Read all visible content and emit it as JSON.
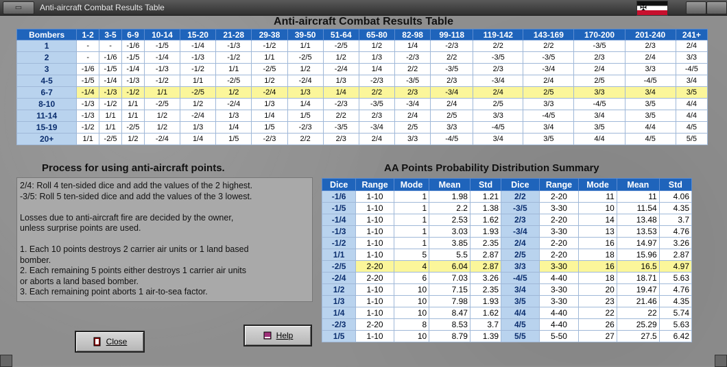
{
  "window": {
    "title": "Anti-aircraft Combat Results Table",
    "menu_label": "▭"
  },
  "crt": {
    "title": "Anti-aircraft Combat Results Table",
    "headers": [
      "Bombers",
      "1-2",
      "3-5",
      "6-9",
      "10-14",
      "15-20",
      "21-28",
      "29-38",
      "39-50",
      "51-64",
      "65-80",
      "82-98",
      "99-118",
      "119-142",
      "143-169",
      "170-200",
      "201-240",
      "241+"
    ],
    "highlight_row": "6-7",
    "rows": [
      [
        "1",
        "-",
        "-",
        "-1/6",
        "-1/5",
        "-1/4",
        "-1/3",
        "-1/2",
        "1/1",
        "-2/5",
        "1/2",
        "1/4",
        "-2/3",
        "2/2",
        "2/2",
        "-3/5",
        "2/3",
        "2/4"
      ],
      [
        "2",
        "-",
        "-1/6",
        "-1/5",
        "-1/4",
        "-1/3",
        "-1/2",
        "1/1",
        "-2/5",
        "1/2",
        "1/3",
        "-2/3",
        "2/2",
        "-3/5",
        "-3/5",
        "2/3",
        "2/4",
        "3/3"
      ],
      [
        "3",
        "-1/6",
        "-1/5",
        "-1/4",
        "-1/3",
        "-1/2",
        "1/1",
        "-2/5",
        "1/2",
        "-2/4",
        "1/4",
        "2/2",
        "-3/5",
        "2/3",
        "-3/4",
        "2/4",
        "3/3",
        "-4/5"
      ],
      [
        "4-5",
        "-1/5",
        "-1/4",
        "-1/3",
        "-1/2",
        "1/1",
        "-2/5",
        "1/2",
        "-2/4",
        "1/3",
        "-2/3",
        "-3/5",
        "2/3",
        "-3/4",
        "2/4",
        "2/5",
        "-4/5",
        "3/4"
      ],
      [
        "6-7",
        "-1/4",
        "-1/3",
        "-1/2",
        "1/1",
        "-2/5",
        "1/2",
        "-2/4",
        "1/3",
        "1/4",
        "2/2",
        "2/3",
        "-3/4",
        "2/4",
        "2/5",
        "3/3",
        "3/4",
        "3/5"
      ],
      [
        "8-10",
        "-1/3",
        "-1/2",
        "1/1",
        "-2/5",
        "1/2",
        "-2/4",
        "1/3",
        "1/4",
        "-2/3",
        "-3/5",
        "-3/4",
        "2/4",
        "2/5",
        "3/3",
        "-4/5",
        "3/5",
        "4/4"
      ],
      [
        "11-14",
        "-1/3",
        "1/1",
        "1/1",
        "1/2",
        "-2/4",
        "1/3",
        "1/4",
        "1/5",
        "2/2",
        "2/3",
        "2/4",
        "2/5",
        "3/3",
        "-4/5",
        "3/4",
        "3/5",
        "4/4"
      ],
      [
        "15-19",
        "-1/2",
        "1/1",
        "-2/5",
        "1/2",
        "1/3",
        "1/4",
        "1/5",
        "-2/3",
        "-3/5",
        "-3/4",
        "2/5",
        "3/3",
        "-4/5",
        "3/4",
        "3/5",
        "4/4",
        "4/5"
      ],
      [
        "20+",
        "1/1",
        "-2/5",
        "1/2",
        "-2/4",
        "1/4",
        "1/5",
        "-2/3",
        "2/2",
        "2/3",
        "2/4",
        "3/3",
        "-4/5",
        "3/4",
        "3/5",
        "4/4",
        "4/5",
        "5/5"
      ]
    ]
  },
  "process": {
    "title": "Process for using anti-aircraft points.",
    "lines": [
      "2/4: Roll 4 ten-sided dice and add the values of the 2 highest.",
      "-3/5: Roll 5 ten-sided dice and add the values of the 3 lowest.",
      "",
      "Losses due to anti-aircraft fire are decided by the owner,",
      "unless surprise points are used.",
      "",
      "1.  Each 10 points destroys 2 carrier air units or 1 land based",
      "bomber.",
      "2.  Each remaining 5 points either destroys 1 carrier air units",
      "or aborts a land based bomber.",
      "3.  Each remaining point aborts 1 air-to-sea factor."
    ]
  },
  "aa_summary": {
    "title": "AA Points Probability Distribution Summary",
    "headers": [
      "Dice",
      "Range",
      "Mode",
      "Mean",
      "Std",
      "Dice",
      "Range",
      "Mode",
      "Mean",
      "Std"
    ],
    "highlight_index": 6,
    "rows": [
      [
        "-1/6",
        "1-10",
        "1",
        "1.98",
        "1.21",
        "2/2",
        "2-20",
        "11",
        "11",
        "4.06"
      ],
      [
        "-1/5",
        "1-10",
        "1",
        "2.2",
        "1.38",
        "-3/5",
        "3-30",
        "10",
        "11.54",
        "4.35"
      ],
      [
        "-1/4",
        "1-10",
        "1",
        "2.53",
        "1.62",
        "2/3",
        "2-20",
        "14",
        "13.48",
        "3.7"
      ],
      [
        "-1/3",
        "1-10",
        "1",
        "3.03",
        "1.93",
        "-3/4",
        "3-30",
        "13",
        "13.53",
        "4.76"
      ],
      [
        "-1/2",
        "1-10",
        "1",
        "3.85",
        "2.35",
        "2/4",
        "2-20",
        "16",
        "14.97",
        "3.26"
      ],
      [
        "1/1",
        "1-10",
        "5",
        "5.5",
        "2.87",
        "2/5",
        "2-20",
        "18",
        "15.96",
        "2.87"
      ],
      [
        "-2/5",
        "2-20",
        "4",
        "6.04",
        "2.87",
        "3/3",
        "3-30",
        "16",
        "16.5",
        "4.97"
      ],
      [
        "-2/4",
        "2-20",
        "6",
        "7.03",
        "3.26",
        "-4/5",
        "4-40",
        "18",
        "18.71",
        "5.63"
      ],
      [
        "1/2",
        "1-10",
        "10",
        "7.15",
        "2.35",
        "3/4",
        "3-30",
        "20",
        "19.47",
        "4.76"
      ],
      [
        "1/3",
        "1-10",
        "10",
        "7.98",
        "1.93",
        "3/5",
        "3-30",
        "23",
        "21.46",
        "4.35"
      ],
      [
        "1/4",
        "1-10",
        "10",
        "8.47",
        "1.62",
        "4/4",
        "4-40",
        "22",
        "22",
        "5.74"
      ],
      [
        "-2/3",
        "2-20",
        "8",
        "8.53",
        "3.7",
        "4/5",
        "4-40",
        "26",
        "25.29",
        "5.63"
      ],
      [
        "1/5",
        "1-10",
        "10",
        "8.79",
        "1.39",
        "5/5",
        "5-50",
        "27",
        "27.5",
        "6.42"
      ]
    ]
  },
  "buttons": {
    "close_label": "Close",
    "help_label": "Help"
  },
  "colors": {
    "header_blue": "#1f64bb",
    "row_head_blue": "#b9d3ee",
    "highlight_yellow": "#fbf69a",
    "panel_gray": "#a9a9a9"
  }
}
